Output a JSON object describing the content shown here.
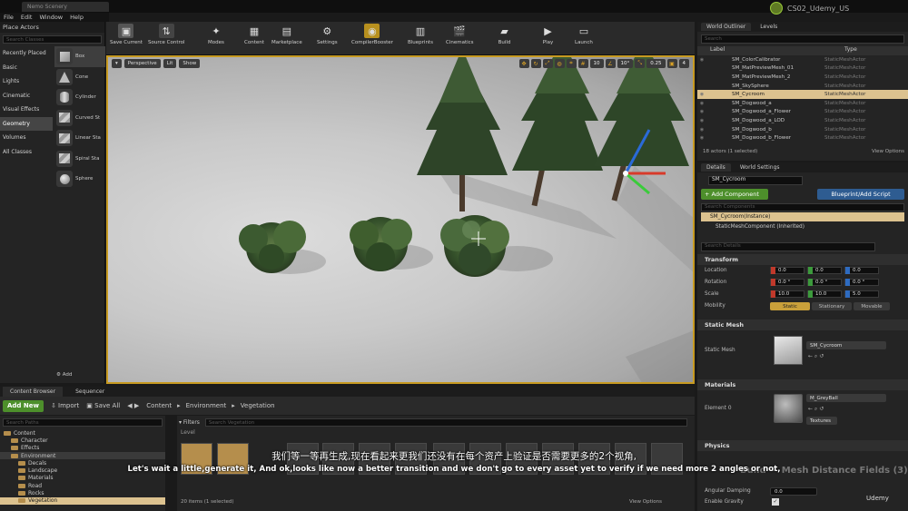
{
  "window": {
    "project_tab": "Nemo Scenery",
    "menu": [
      "File",
      "Edit",
      "Window",
      "Help"
    ],
    "user": "CS02_Udemy_US"
  },
  "place_actors": {
    "title": "Place Actors",
    "search_placeholder": "Search Classes",
    "categories": [
      "Recently Placed",
      "Basic",
      "Lights",
      "Cinematic",
      "Visual Effects",
      "Geometry",
      "Volumes",
      "All Classes"
    ],
    "selected_category": "Geometry",
    "shapes": [
      "Box",
      "Cone",
      "Cylinder",
      "Curved St",
      "Linear Sta",
      "Spiral Sta",
      "Sphere"
    ],
    "footer": "Add"
  },
  "toolbar": {
    "buttons": [
      "Save Current",
      "Source Control",
      "Modes",
      "Content",
      "Marketplace",
      "Settings",
      "CompilerBooster",
      "Blueprints",
      "Cinematics",
      "Build",
      "Play",
      "Launch"
    ]
  },
  "viewport": {
    "left_buttons": [
      "Perspective",
      "Lit",
      "Show"
    ],
    "snap_values": [
      "10",
      "10°",
      "0.25",
      "4"
    ]
  },
  "outliner": {
    "tabs": [
      "World Outliner",
      "Levels"
    ],
    "search_placeholder": "Search",
    "col_label": "Label",
    "col_type": "Type",
    "rows": [
      {
        "label": "SM_ColorCalibrator",
        "type": "StaticMeshActor"
      },
      {
        "label": "SM_MatPreviewMesh_01",
        "type": "StaticMeshActor"
      },
      {
        "label": "SM_MatPreviewMesh_2",
        "type": "StaticMeshActor"
      },
      {
        "label": "SM_SkySphere",
        "type": "StaticMeshActor"
      },
      {
        "label": "SM_Cycroom",
        "type": "StaticMeshActor"
      },
      {
        "label": "SM_Dogwood_a",
        "type": "StaticMeshActor"
      },
      {
        "label": "SM_Dogwood_a_Flower",
        "type": "StaticMeshActor"
      },
      {
        "label": "SM_Dogwood_a_LOD",
        "type": "StaticMeshActor"
      },
      {
        "label": "SM_Dogwood_b",
        "type": "StaticMeshActor"
      },
      {
        "label": "SM_Dogwood_b_Flower",
        "type": "StaticMeshActor"
      }
    ],
    "selected_index": 4,
    "footer_count": "18 actors (1 selected)",
    "footer_view": "View Options"
  },
  "details": {
    "tabs": [
      "Details",
      "World Settings"
    ],
    "actor_name": "SM_Cycroom",
    "add_component": "+ Add Component",
    "blueprint_script": "Blueprint/Add Script",
    "search_components": "Search Components",
    "component_root": "SM_Cycroom(Instance)",
    "component_child": "StaticMeshComponent (Inherited)",
    "search_details": "Search Details",
    "transform": {
      "title": "Transform",
      "location_label": "Location",
      "rotation_label": "Rotation",
      "scale_label": "Scale",
      "location": [
        "0.0",
        "0.0",
        "0.0"
      ],
      "rotation": [
        "0.0 °",
        "0.0 °",
        "0.0 °"
      ],
      "scale": [
        "10.0",
        "10.0",
        "5.0"
      ],
      "mobility_label": "Mobility",
      "mobility_options": [
        "Static",
        "Stationary",
        "Movable"
      ]
    },
    "static_mesh": {
      "title": "Static Mesh",
      "label": "Static Mesh",
      "value": "SM_Cycroom"
    },
    "materials": {
      "title": "Materials",
      "element_label": "Element 0",
      "value": "M_GreyBall",
      "textures": "Textures"
    },
    "physics": {
      "title": "Physics",
      "angular_damping_label": "Angular Damping",
      "angular_damping": "0.0",
      "enable_gravity_label": "Enable Gravity"
    },
    "overlay_heading": "Build — Mesh Distance Fields (3)"
  },
  "content_browser": {
    "tabs": [
      "Content Browser",
      "Sequencer"
    ],
    "add_new": "Add New",
    "import": "Import",
    "save_all": "Save All",
    "path": [
      "Content",
      "Environment",
      "Vegetation"
    ],
    "search_paths": "Search Paths",
    "filters": "Filters",
    "search_placeholder": "Search Vegetation",
    "level": "Level",
    "tree": [
      "Content",
      "Character",
      "Effects",
      "Environment",
      "Decals",
      "Landscape",
      "Materials",
      "Road",
      "Rocks",
      "Vegetation"
    ],
    "footer_count": "20 items (1 selected)",
    "footer_view": "View Options"
  },
  "subtitles": {
    "cn": "我们等一等再生成,现在看起来更我们还没有在每个资产上验证是否需要更多的2个视角,",
    "en": "Let's wait a little,generate it, And ok,looks like now a better transition and we don't go to every asset yet to verify if we need more 2 angles or not,"
  },
  "watermark": "Udemy",
  "colors": {
    "accent_orange": "#c79a21",
    "add_green": "#4d8f2b",
    "blueprint_blue": "#2e5c91",
    "selection": "#dcc28f"
  }
}
